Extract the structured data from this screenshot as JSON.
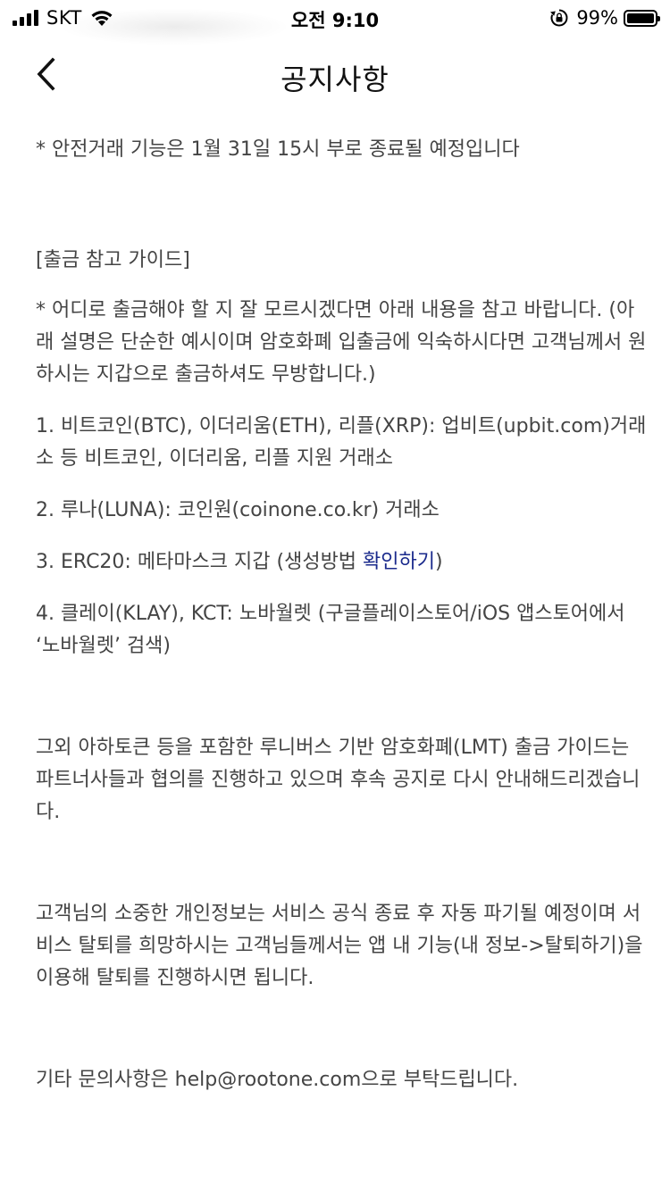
{
  "status_bar": {
    "carrier": "SKT",
    "time": "오전 9:10",
    "battery_percent": "99%",
    "battery_level": 0.99,
    "icons": [
      "signal-icon",
      "wifi-icon",
      "rotation-lock-icon",
      "battery-icon"
    ]
  },
  "nav": {
    "back_icon": "chevron-left-icon",
    "title": "공지사항"
  },
  "content": {
    "notice_line": "* 안전거래 기능은 1월 31일 15시 부로 종료될 예정입니다",
    "guide_title": "[출금 참고 가이드]",
    "guide_intro": "* 어디로 출금해야 할 지 잘 모르시겠다면 아래 내용을 참고 바랍니다. (아래 설명은 단순한 예시이며 암호화폐 입출금에 익숙하시다면 고객님께서 원하시는 지갑으로 출금하셔도 무방합니다.)",
    "item_1": "1. 비트코인(BTC), 이더리움(ETH), 리플(XRP): 업비트(upbit.com)거래소 등 비트코인, 이더리움, 리플 지원 거래소",
    "item_2": "2. 루나(LUNA): 코인원(coinone.co.kr) 거래소",
    "item_3_text": "3. ERC20: 메타마스크 지갑 (생성방법 ",
    "item_3_link": "확인하기",
    "item_3_close": ")",
    "item_4": "4. 클레이(KLAY), KCT: 노바월렛 (구글플레이스토어/iOS 앱스토어에서 ‘노바월렛’ 검색)",
    "lmt_notice": "그외 아하토큰 등을 포함한 루니버스 기반 암호화폐(LMT) 출금 가이드는 파트너사들과 협의를 진행하고 있으며 후속 공지로 다시 안내해드리겠습니다.",
    "privacy_notice": "고객님의 소중한 개인정보는 서비스 공식 종료 후 자동 파기될 예정이며 서비스 탈퇴를 희망하시는 고객님들께서는 앱 내 기능(내 정보->탈퇴하기)을 이용해 탈퇴를 진행하시면 됩니다.",
    "contact": "기타 문의사항은 help@rootone.com으로 부탁드립니다."
  },
  "colors": {
    "text": "#444444",
    "title": "#111111",
    "link": "#1a2a8c",
    "background": "#ffffff"
  }
}
